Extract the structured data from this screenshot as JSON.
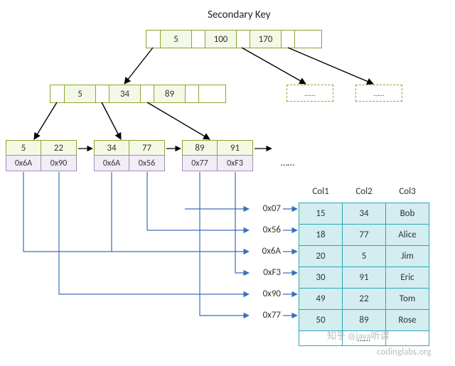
{
  "title": "Secondary Key",
  "levels": {
    "root": {
      "keys": [
        "5",
        "100",
        "170"
      ]
    },
    "mid": {
      "keys": [
        "5",
        "34",
        "89"
      ]
    }
  },
  "leaves": [
    {
      "keys": [
        "5",
        "22"
      ],
      "ptrs": [
        "0x6A",
        "0x90"
      ]
    },
    {
      "keys": [
        "34",
        "77"
      ],
      "ptrs": [
        "0x6A",
        "0x56"
      ]
    },
    {
      "keys": [
        "89",
        "91"
      ],
      "ptrs": [
        "0x77",
        "0xF3"
      ]
    }
  ],
  "ellipsis_leaf": "……",
  "ellipsis_ph": "……",
  "heap_pointers": [
    "0x07",
    "0x56",
    "0x6A",
    "0xF3",
    "0x90",
    "0x77"
  ],
  "table": {
    "headers": [
      "Col1",
      "Col2",
      "Col3"
    ],
    "rows": [
      [
        "15",
        "34",
        "Bob"
      ],
      [
        "18",
        "77",
        "Alice"
      ],
      [
        "20",
        "5",
        "Jim"
      ],
      [
        "30",
        "91",
        "Eric"
      ],
      [
        "49",
        "22",
        "Tom"
      ],
      [
        "50",
        "89",
        "Rose"
      ]
    ],
    "extra_row": [
      "",
      "……",
      ""
    ]
  },
  "watermark_site": "codinglabs.org",
  "watermark_zhihu": "知乎 @java听课"
}
